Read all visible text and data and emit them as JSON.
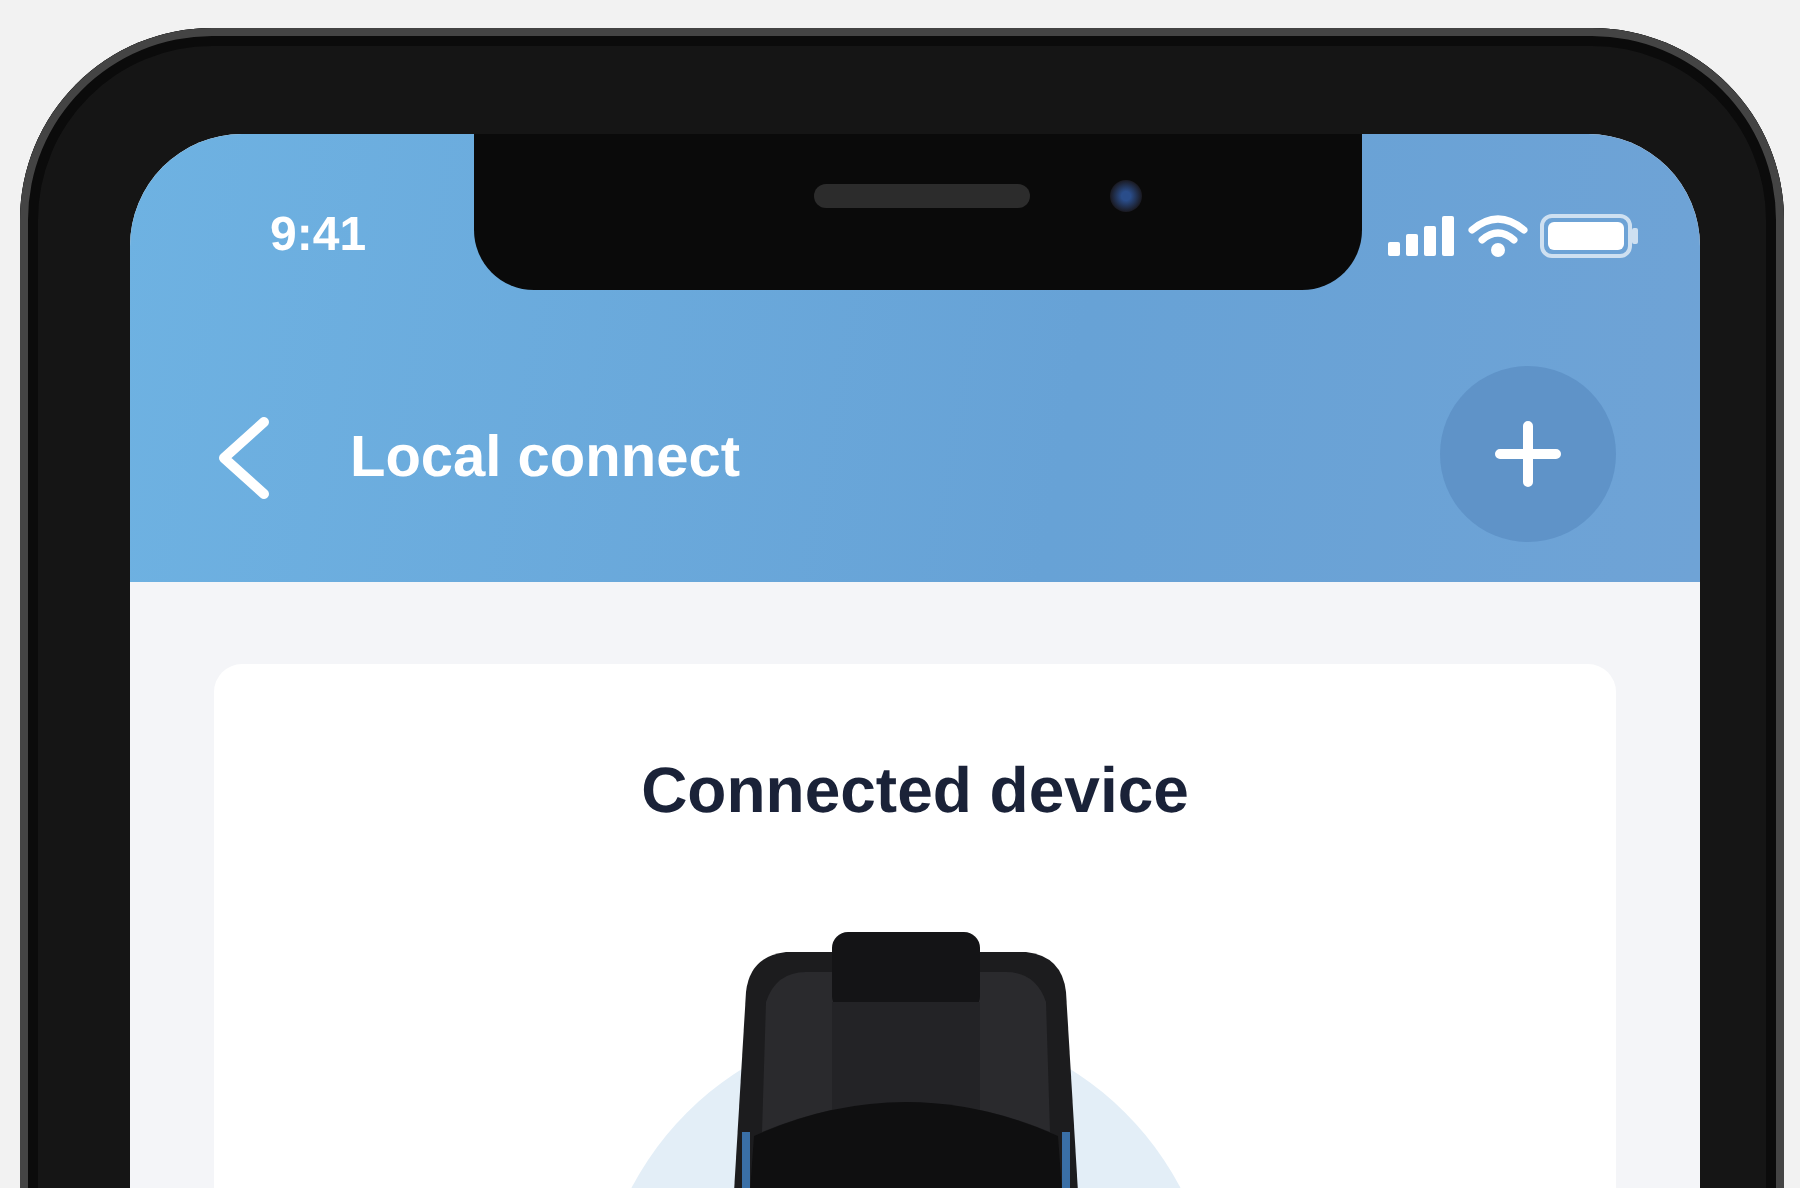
{
  "status_bar": {
    "time": "9:41"
  },
  "header": {
    "title": "Local connect"
  },
  "card": {
    "title": "Connected device"
  }
}
